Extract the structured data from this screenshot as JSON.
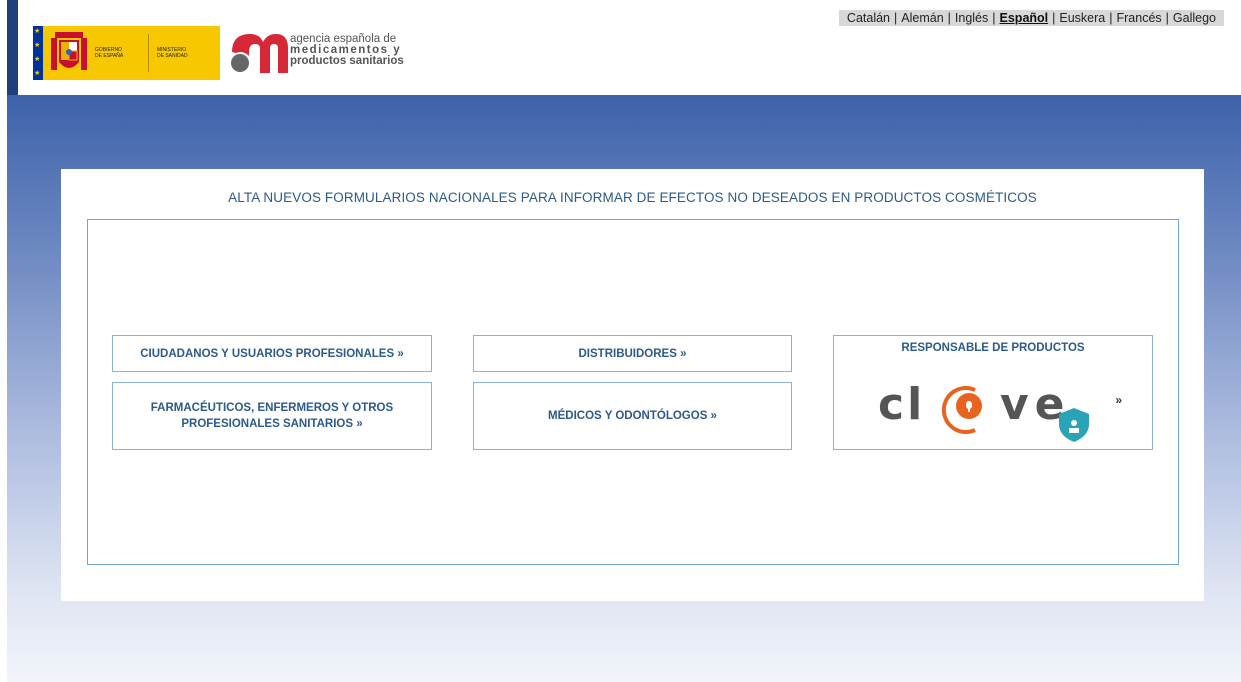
{
  "languages": [
    {
      "label": "Catalán",
      "active": false
    },
    {
      "label": "Alemán",
      "active": false
    },
    {
      "label": "Inglés",
      "active": false
    },
    {
      "label": "Español",
      "active": true
    },
    {
      "label": "Euskera",
      "active": false
    },
    {
      "label": "Francés",
      "active": false
    },
    {
      "label": "Gallego",
      "active": false
    }
  ],
  "language_separator": "|",
  "gov_logo": {
    "line1": "GOBIERNO",
    "line2": "DE ESPAÑA",
    "line3": "MINISTERIO",
    "line4": "DE SANIDAD"
  },
  "aemps_logo": {
    "line1": "agencia española de",
    "line2": "medicamentos y",
    "line3": "productos sanitarios"
  },
  "page_title": "ALTA NUEVOS FORMULARIOS NACIONALES PARA INFORMAR DE EFECTOS NO DESEADOS EN PRODUCTOS COSMÉTICOS",
  "options": {
    "ciudadanos": "CIUDADANOS Y USUARIOS PROFESIONALES »",
    "farmaceuticos": "FARMACÉUTICOS, ENFERMEROS Y OTROS PROFESIONALES SANITARIOS »",
    "distribuidores": "DISTRIBUIDORES »",
    "medicos": "MÉDICOS Y ODONTÓLOGOS »",
    "responsable": "RESPONSABLE DE PRODUCTOS",
    "clave_arrow": "»"
  },
  "colors": {
    "accent_text": "#2c5a8a",
    "border": "#8bb4d2",
    "clave_orange": "#e8641e",
    "clave_shield": "#2aa3b8",
    "gov_yellow": "#f7c800",
    "aemps_red": "#d62836"
  }
}
